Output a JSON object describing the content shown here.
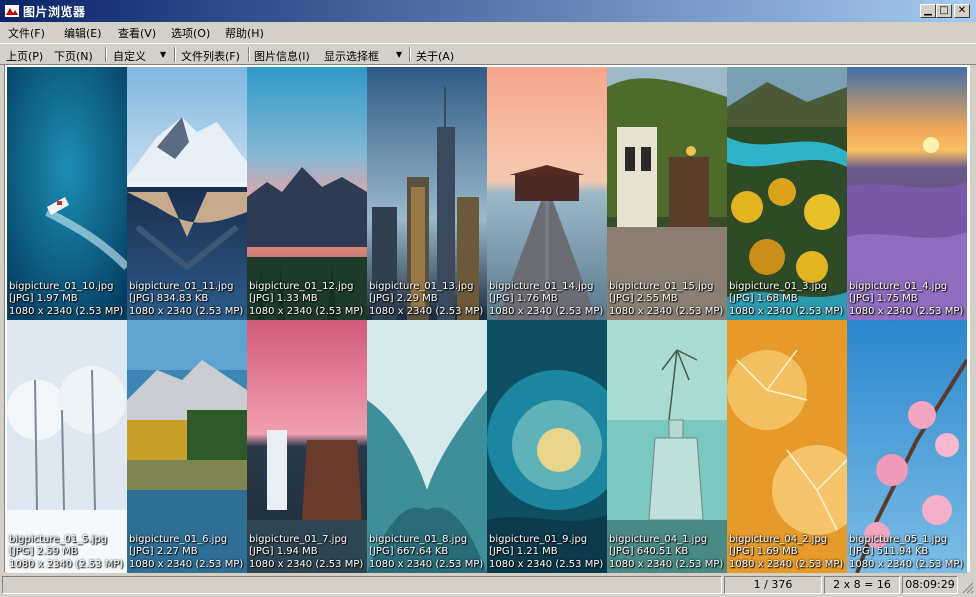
{
  "window": {
    "title": "图片浏览器"
  },
  "menu": [
    "文件(F)",
    "编辑(E)",
    "查看(V)",
    "选项(O)",
    "帮助(H)"
  ],
  "toolbar": {
    "prev_page": "上页(P)",
    "next_page": "下页(N)",
    "custom": "自定义",
    "file_list": "文件列表(F)",
    "image_info": "图片信息(I)",
    "show_selection": "显示选择框",
    "about": "关于(A)"
  },
  "thumbnails": [
    {
      "name": "bigpicture_01_10.jpg",
      "size": "[JPG] 1.97 MB",
      "dims": "1080 x 2340 (2.53 MP)",
      "scene": "speedboat on blue sea"
    },
    {
      "name": "bigpicture_01_11.jpg",
      "size": "[JPG] 834.83 KB",
      "dims": "1080 x 2340 (2.53 MP)",
      "scene": "snowy mountain reflected in lake"
    },
    {
      "name": "bigpicture_01_12.jpg",
      "size": "[JPG] 1.33 MB",
      "dims": "1080 x 2340 (2.53 MP)",
      "scene": "pink sky over mountain lake"
    },
    {
      "name": "bigpicture_01_13.jpg",
      "size": "[JPG] 2.29 MB",
      "dims": "1080 x 2340 (2.53 MP)",
      "scene": "city skyscrapers at dusk"
    },
    {
      "name": "bigpicture_01_14.jpg",
      "size": "[JPG] 1.76 MB",
      "dims": "1080 x 2340 (2.53 MP)",
      "scene": "wooden pier to boathouse at sunset"
    },
    {
      "name": "bigpicture_01_15.jpg",
      "size": "[JPG] 2.55 MB",
      "dims": "1080 x 2340 (2.53 MP)",
      "scene": "ivy covered house"
    },
    {
      "name": "bigpicture_01_3.jpg",
      "size": "[JPG] 1.68 MB",
      "dims": "1080 x 2340 (2.53 MP)",
      "scene": "autumn forest and river"
    },
    {
      "name": "bigpicture_01_4.jpg",
      "size": "[JPG] 1.75 MB",
      "dims": "1080 x 2340 (2.53 MP)",
      "scene": "lavender field at sunset"
    },
    {
      "name": "bigpicture_01_5.jpg",
      "size": "[JPG] 2.59 MB",
      "dims": "1080 x 2340 (2.53 MP)",
      "scene": "snow covered trees"
    },
    {
      "name": "bigpicture_01_6.jpg",
      "size": "[JPG] 2.27 MB",
      "dims": "1080 x 2340 (2.53 MP)",
      "scene": "mountain lake autumn reflection"
    },
    {
      "name": "bigpicture_01_7.jpg",
      "size": "[JPG] 1.94 MB",
      "dims": "1080 x 2340 (2.53 MP)",
      "scene": "waterfall under pink sky"
    },
    {
      "name": "bigpicture_01_8.jpg",
      "size": "[JPG] 667.64 KB",
      "dims": "1080 x 2340 (2.53 MP)",
      "scene": "ice cave"
    },
    {
      "name": "bigpicture_01_9.jpg",
      "size": "[JPG] 1.21 MB",
      "dims": "1080 x 2340 (2.53 MP)",
      "scene": "ocean wave curl"
    },
    {
      "name": "bigpicture_04_1.jpg",
      "size": "[JPG] 640.51 KB",
      "dims": "1080 x 2340 (2.53 MP)",
      "scene": "glass bottle with dried plant"
    },
    {
      "name": "bigpicture_04_2.jpg",
      "size": "[JPG] 1.69 MB",
      "dims": "1080 x 2340 (2.53 MP)",
      "scene": "dandelion seeds golden"
    },
    {
      "name": "bigpicture_05_1.jpg",
      "size": "[JPG] 511.94 KB",
      "dims": "1080 x 2340 (2.53 MP)",
      "scene": "pink magnolia on blue sky"
    }
  ],
  "status": {
    "position": "1 / 376",
    "layout": "2 x 8 = 16",
    "time": "08:09:29"
  }
}
